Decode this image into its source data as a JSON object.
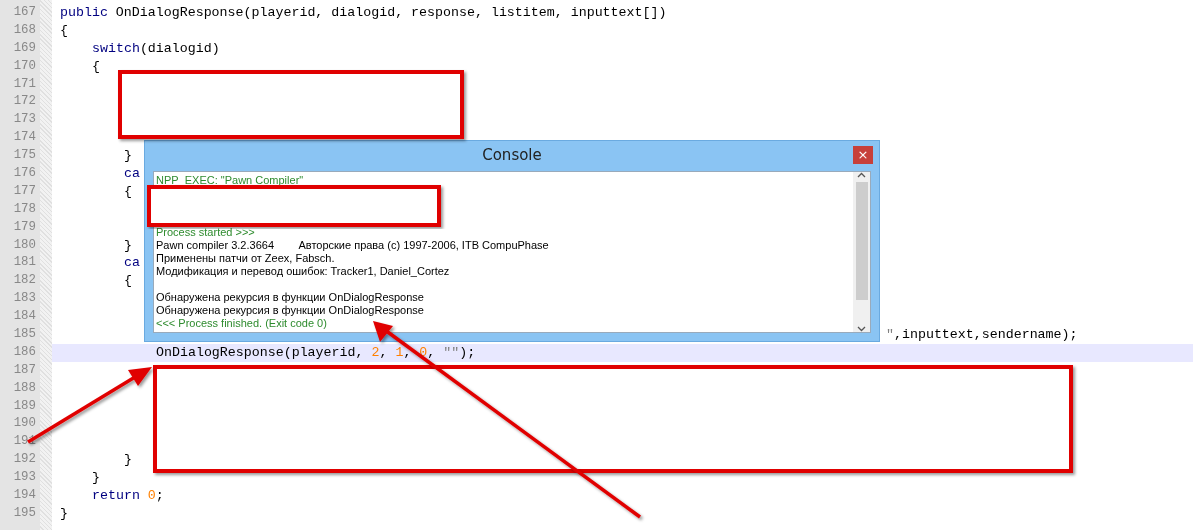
{
  "editor": {
    "lines": [
      {
        "number": "167",
        "selected": false,
        "tokens": [
          {
            "text": "public",
            "kind": "keyword"
          },
          {
            "text": " OnDialogResponse(playerid, dialogid, response, listitem, inputtext[])",
            "kind": "plain"
          }
        ]
      },
      {
        "number": "168",
        "selected": false,
        "tokens": [
          {
            "text": "{",
            "kind": "plain"
          }
        ],
        "children": [
          {
            "number": "169",
            "selected": false,
            "tokens": [
              {
                "text": "switch",
                "kind": "keyword"
              },
              {
                "text": "(dialogid)",
                "kind": "plain"
              }
            ]
          },
          {
            "number": "170",
            "selected": false,
            "tokens": [
              {
                "text": "{",
                "kind": "plain"
              }
            ],
            "children": [
              {
                "number": "171",
                "selected": false
              },
              {
                "number": "172",
                "selected": false
              },
              {
                "number": "173",
                "selected": false
              },
              {
                "number": "174",
                "selected": false
              },
              {
                "number": "175",
                "selected": false,
                "tokens": [
                  {
                    "text": "}",
                    "kind": "plain"
                  }
                ]
              },
              {
                "number": "176",
                "selected": false,
                "tokens": [
                  {
                    "text": "ca",
                    "kind": "keyword"
                  }
                ]
              },
              {
                "number": "177",
                "selected": false,
                "tokens": [
                  {
                    "text": "{",
                    "kind": "plain"
                  }
                ],
                "children": [
                  {
                    "number": "178",
                    "selected": false
                  },
                  {
                    "number": "179",
                    "selected": false
                  }
                ]
              },
              {
                "number": "180",
                "selected": false,
                "tokens": [
                  {
                    "text": "}",
                    "kind": "plain"
                  }
                ]
              },
              {
                "number": "181",
                "selected": false,
                "tokens": [
                  {
                    "text": "ca",
                    "kind": "keyword"
                  }
                ]
              },
              {
                "number": "182",
                "selected": false,
                "tokens": [
                  {
                    "text": "{",
                    "kind": "plain"
                  }
                ],
                "children": [
                  {
                    "number": "183",
                    "selected": false
                  },
                  {
                    "number": "184",
                    "selected": false
                  },
                  {
                    "number": "185",
                    "selected": false,
                    "covered": true,
                    "tokens": [
                      {
                        "text": "\"",
                        "kind": "string"
                      },
                      {
                        "text": ",inputtext,sendername);",
                        "kind": "plain"
                      }
                    ]
                  },
                  {
                    "number": "186",
                    "selected": true,
                    "tokens": [
                      {
                        "text": "OnDialogResponse(playerid, ",
                        "kind": "plain"
                      },
                      {
                        "text": "2",
                        "kind": "number"
                      },
                      {
                        "text": ", ",
                        "kind": "plain"
                      },
                      {
                        "text": "1",
                        "kind": "number"
                      },
                      {
                        "text": ", ",
                        "kind": "plain"
                      },
                      {
                        "text": "0",
                        "kind": "number"
                      },
                      {
                        "text": ", ",
                        "kind": "plain"
                      },
                      {
                        "text": "\"\"",
                        "kind": "string"
                      },
                      {
                        "text": ");",
                        "kind": "plain"
                      }
                    ]
                  },
                  {
                    "number": "187",
                    "selected": false
                  },
                  {
                    "number": "188",
                    "selected": false
                  },
                  {
                    "number": "189",
                    "selected": false
                  },
                  {
                    "number": "190",
                    "selected": false
                  },
                  {
                    "number": "191",
                    "selected": false
                  }
                ]
              },
              {
                "number": "192",
                "selected": false,
                "tokens": [
                  {
                    "text": "}",
                    "kind": "plain"
                  }
                ]
              }
            ]
          },
          {
            "number": "193",
            "selected": false,
            "tokens": [
              {
                "text": "}",
                "kind": "plain"
              }
            ]
          },
          {
            "number": "194",
            "selected": false,
            "tokens": [
              {
                "text": "return ",
                "kind": "keyword"
              },
              {
                "text": "0",
                "kind": "number"
              },
              {
                "text": ";",
                "kind": "plain"
              }
            ]
          }
        ]
      },
      {
        "number": "195",
        "selected": false,
        "tokens": [
          {
            "text": "}",
            "kind": "plain"
          }
        ]
      }
    ]
  },
  "console": {
    "title": "Console",
    "close": "×",
    "lines": [
      {
        "kind": "info",
        "text": "NPP_EXEC: \"Pawn Compiler\""
      },
      {
        "kind": "blank"
      },
      {
        "kind": "blank"
      },
      {
        "kind": "blank"
      },
      {
        "kind": "info",
        "text": "Process started >>>"
      },
      {
        "kind": "output",
        "text": "Pawn compiler 3.2.3664        Авторские права (c) 1997-2006, ITB CompuPhase"
      },
      {
        "kind": "output",
        "text": "Применены патчи от Zeex, Fabsch."
      },
      {
        "kind": "output",
        "text": "Модификация и перевод ошибок: Tracker1, Daniel_Cortez"
      },
      {
        "kind": "blank"
      },
      {
        "kind": "output",
        "text": "Обнаружена рекурсия в функции OnDialogResponse"
      },
      {
        "kind": "output",
        "text": "Обнаружена рекурсия в функции OnDialogResponse"
      },
      {
        "kind": "info",
        "text": "<<< Process finished. (Exit code 0)"
      }
    ]
  }
}
